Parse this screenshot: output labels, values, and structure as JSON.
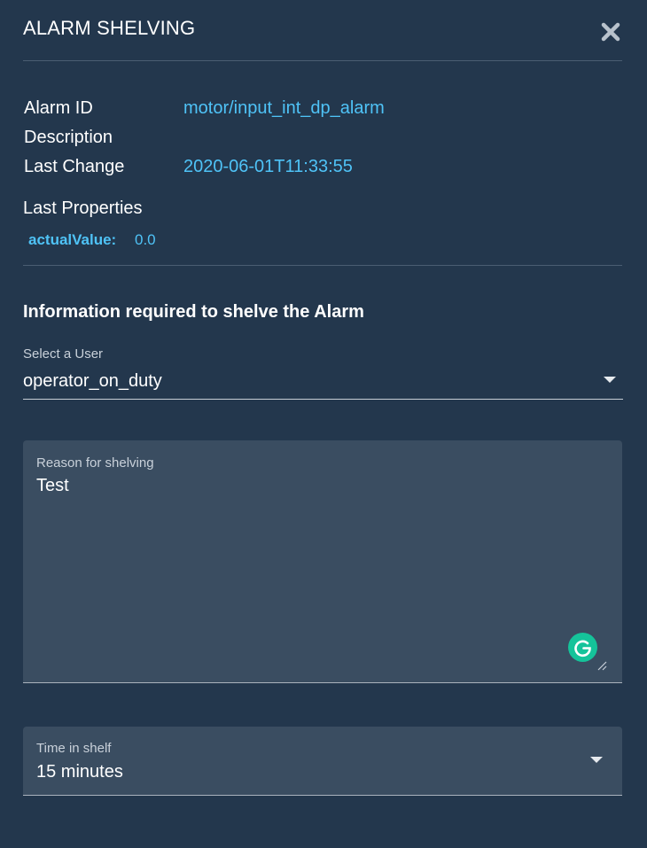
{
  "dialog": {
    "title": "ALARM SHELVING",
    "close_icon": "close-icon"
  },
  "details": {
    "alarm_id_label": "Alarm ID",
    "alarm_id_value": "motor/input_int_dp_alarm",
    "description_label": "Description",
    "description_value": "",
    "last_change_label": "Last Change",
    "last_change_value": "2020-06-01T11:33:55"
  },
  "properties": {
    "label": "Last Properties",
    "items": [
      {
        "key": "actualValue:",
        "value": "0.0"
      }
    ]
  },
  "form": {
    "heading": "Information required to shelve the Alarm",
    "user_select": {
      "label": "Select a User",
      "value": "operator_on_duty"
    },
    "reason": {
      "label": "Reason for shelving",
      "value": "Test"
    },
    "time_in_shelf": {
      "label": "Time in shelf",
      "value": "15 minutes"
    }
  },
  "colors": {
    "background": "#23374d",
    "field_background": "#3a4d61",
    "accent": "#4fc3f7",
    "grammarly": "#15c39a"
  }
}
